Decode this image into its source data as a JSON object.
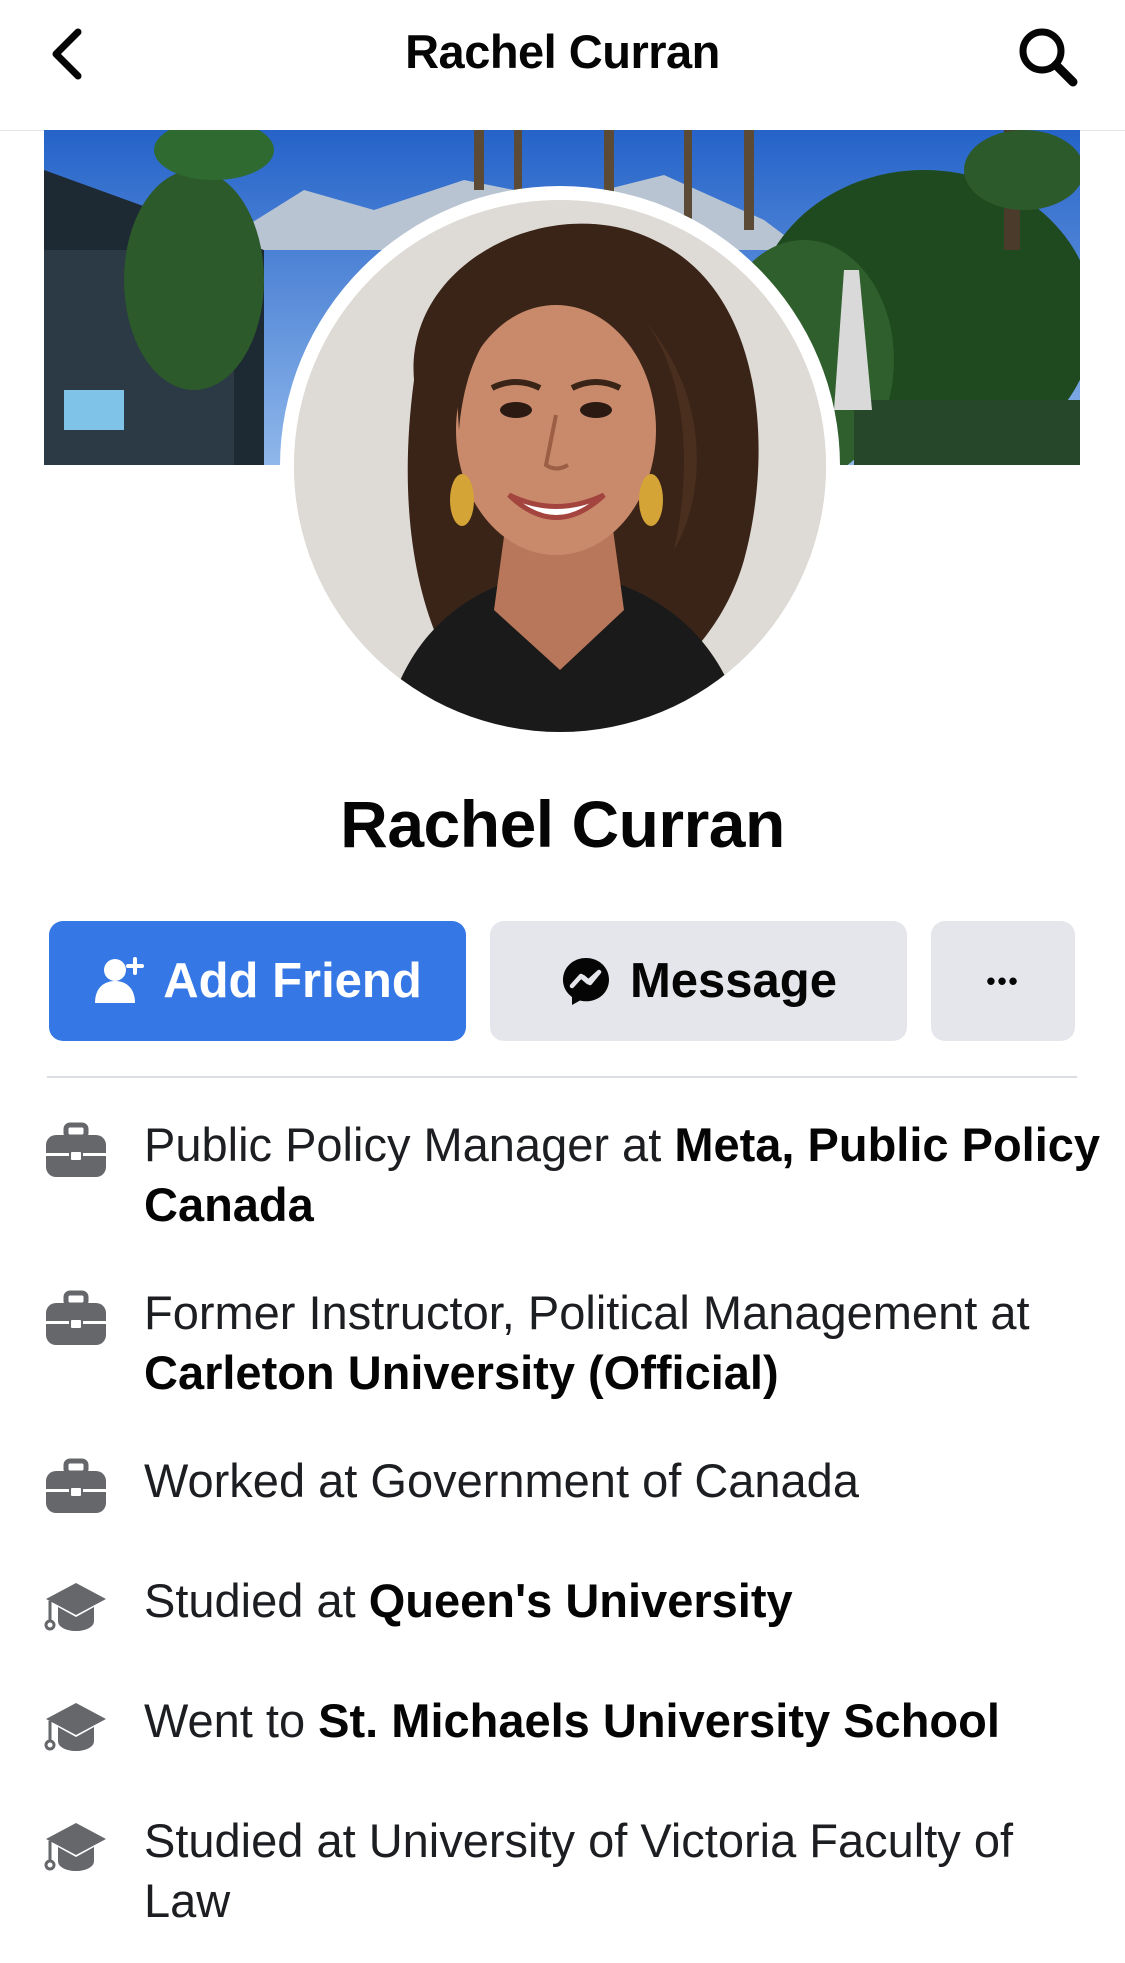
{
  "header": {
    "title": "Rachel Curran",
    "back_icon": "chevron-left-icon",
    "search_icon": "search-icon"
  },
  "profile": {
    "name": "Rachel Curran"
  },
  "actions": {
    "add_friend_label": "Add Friend",
    "message_label": "Message",
    "more_label": "•••"
  },
  "info": [
    {
      "icon": "briefcase-icon",
      "prefix": "Public Policy Manager at ",
      "bold": "Meta, Public Policy Canada"
    },
    {
      "icon": "briefcase-icon",
      "prefix": "Former Instructor, Political Management at ",
      "bold": "Carleton University (Official)"
    },
    {
      "icon": "briefcase-icon",
      "prefix": "Worked at Government of Canada",
      "bold": ""
    },
    {
      "icon": "graduation-cap-icon",
      "prefix": "Studied at ",
      "bold": "Queen's University"
    },
    {
      "icon": "graduation-cap-icon",
      "prefix": "Went to ",
      "bold": "St. Michaels University School"
    },
    {
      "icon": "graduation-cap-icon",
      "prefix": "Studied at University of Victoria Faculty of Law",
      "bold": ""
    }
  ],
  "colors": {
    "primary": "#3578e5",
    "secondary_button": "#e4e6eb",
    "text": "#050505",
    "icon_gray": "#65676b"
  }
}
